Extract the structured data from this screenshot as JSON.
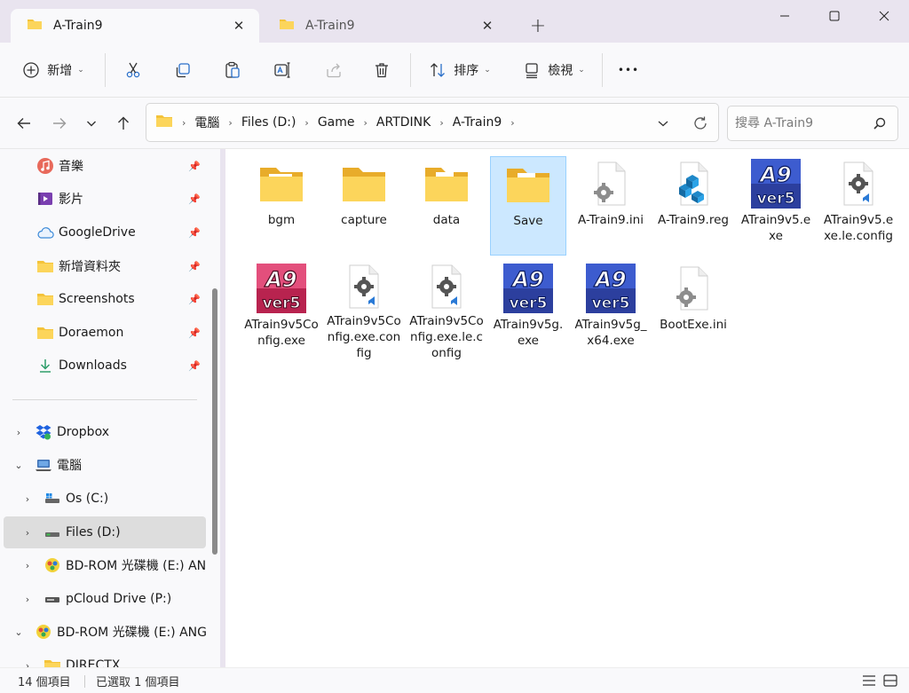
{
  "window": {
    "tabs": [
      {
        "title": "A-Train9",
        "active": true
      },
      {
        "title": "A-Train9",
        "active": false
      }
    ],
    "new_tab_symbol": "+",
    "close_tab_symbol": "✕"
  },
  "toolbar": {
    "new_label": "新增",
    "sort_label": "排序",
    "view_label": "檢視",
    "more_symbol": "•••",
    "icons": [
      "cut-icon",
      "copy-icon",
      "paste-icon",
      "rename-icon",
      "share-icon",
      "delete-icon"
    ]
  },
  "address": {
    "path": [
      "電腦",
      "Files (D:)",
      "Game",
      "ARTDINK",
      "A-Train9"
    ]
  },
  "search": {
    "placeholder": "搜尋 A-Train9"
  },
  "sidebar": {
    "quick_access": [
      {
        "label": "音樂",
        "icon": "music-icon"
      },
      {
        "label": "影片",
        "icon": "video-icon"
      },
      {
        "label": "GoogleDrive",
        "icon": "cloud-icon"
      },
      {
        "label": "新增資料夾",
        "icon": "folder-icon"
      },
      {
        "label": "Screenshots",
        "icon": "folder-icon"
      },
      {
        "label": "Doraemon",
        "icon": "folder-icon"
      },
      {
        "label": "Downloads",
        "icon": "download-icon"
      }
    ],
    "tree": [
      {
        "label": "Dropbox",
        "icon": "dropbox-icon",
        "expander": "›"
      },
      {
        "label": "電腦",
        "icon": "computer-icon",
        "expander": "⌄"
      },
      {
        "label": "Os (C:)",
        "icon": "drive-icon",
        "expander": "›"
      },
      {
        "label": "Files (D:)",
        "icon": "drive-icon",
        "expander": "›"
      },
      {
        "label": "BD-ROM 光碟機 (E:) ANG",
        "icon": "disc-icon",
        "expander": "›"
      },
      {
        "label": "pCloud Drive (P:)",
        "icon": "drive-icon",
        "expander": "›"
      },
      {
        "label": "BD-ROM 光碟機 (E:) ANG",
        "icon": "disc-icon",
        "expander": "⌄"
      },
      {
        "label": "DIRECTX",
        "icon": "folder-icon",
        "expander": "›"
      }
    ]
  },
  "files": [
    {
      "name": "bgm",
      "type": "folder"
    },
    {
      "name": "capture",
      "type": "folder"
    },
    {
      "name": "data",
      "type": "folder"
    },
    {
      "name": "Save",
      "type": "folder",
      "selected": true
    },
    {
      "name": "A-Train9.ini",
      "type": "ini"
    },
    {
      "name": "A-Train9.reg",
      "type": "reg"
    },
    {
      "name": "ATrain9v5.exe",
      "type": "a9exe"
    },
    {
      "name": "ATrain9v5.exe.le.config",
      "type": "config"
    },
    {
      "name": "ATrain9v5Config.exe",
      "type": "a9cfg"
    },
    {
      "name": "ATrain9v5Config.exe.config",
      "type": "config"
    },
    {
      "name": "ATrain9v5Config.exe.le.config",
      "type": "config"
    },
    {
      "name": "ATrain9v5g.exe",
      "type": "a9exe"
    },
    {
      "name": "ATrain9v5g_x64.exe",
      "type": "a9exe"
    },
    {
      "name": "BootExe.ini",
      "type": "ini"
    }
  ],
  "a9_logo": {
    "top": "A9",
    "bottom": "ver5"
  },
  "status": {
    "item_count": "14 個項目",
    "selected": "已選取 1 個項目"
  }
}
